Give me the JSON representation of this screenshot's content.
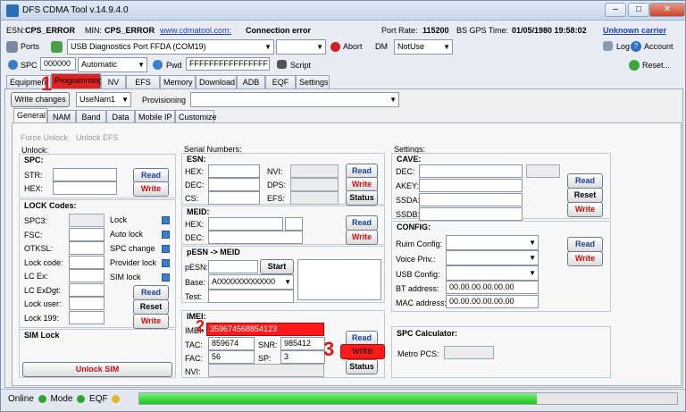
{
  "window": {
    "title": "DFS CDMA Tool v.14.9.4.0"
  },
  "infobar": {
    "esn_label": "ESN:",
    "esn_value": "CPS_ERROR",
    "min_label": "MIN:",
    "min_value": "CPS_ERROR",
    "website": "www.cdmatool.com:",
    "connection": "Connection error",
    "port_rate_label": "Port Rate:",
    "port_rate_value": "115200",
    "gps_label": "BS GPS Time:",
    "gps_value": "01/05/1980 19:58:02",
    "carrier": "Unknown carrier"
  },
  "toolbar1": {
    "ports_label": "Ports",
    "port_select": "USB Diagnostics Port FFDA (COM19)",
    "abort_label": "Abort",
    "dm_label": "DM",
    "dm_select": "NotUse",
    "log_label": "Log",
    "account_label": "Account"
  },
  "toolbar2": {
    "spc_label": "SPC",
    "spc_value": "000000",
    "spc_mode": "Automatic",
    "pwd_label": "Pwd",
    "pwd_value": "FFFFFFFFFFFFFFFF",
    "script_label": "Script",
    "reset_label": "Reset..."
  },
  "main_tabs": [
    "Equipment",
    "Programming",
    "NV",
    "EFS",
    "Memory",
    "Download",
    "ADB",
    "EQF",
    "Settings"
  ],
  "prog_toolbar": {
    "write_changes": "Write changes",
    "profile": "UseNam1",
    "provisioning_label": "Provisioning"
  },
  "sub_tabs": [
    "General",
    "NAM",
    "Band",
    "Data",
    "Mobile IP",
    "Customize"
  ],
  "unlock": {
    "title": "Unlock:",
    "force_unlock": "Force Unlock",
    "unlock_efs": "Unlock EFS",
    "spc_title": "SPC:",
    "str_label": "STR:",
    "hex_label": "HEX:",
    "read": "Read",
    "write": "Write",
    "lock_codes_title": "LOCK Codes:",
    "codes": [
      "SPC3:",
      "FSC:",
      "OTKSL:",
      "Lock code:",
      "LC Ex:",
      "LC ExDgt:",
      "Lock user:",
      "Lock 199:"
    ],
    "locks": [
      "Lock",
      "Auto lock",
      "SPC change",
      "Provider lock",
      "SIM lock"
    ],
    "reset": "Reset",
    "sim_lock_title": "SIM Lock",
    "unlock_sim": "Unlock SIM"
  },
  "serial": {
    "title": "Serial Numbers:",
    "esn_title": "ESN:",
    "hex_label": "HEX:",
    "dec_label": "DEC:",
    "cs_label": "CS:",
    "nvi_label": "NVI:",
    "dps_label": "DPS:",
    "efs_label": "EFS:",
    "read": "Read",
    "write": "Write",
    "status": "Status",
    "meid_title": "MEID:",
    "pesn_title": "pESN -> MEID",
    "pesn_label": "pESN:",
    "start": "Start",
    "base_label": "Base:",
    "base_value": "A0000000000000",
    "test_label": "Test:",
    "imei_title": "IMEI:",
    "imei_label": "IMEI:",
    "imei_value": "359674568854123",
    "tac_label": "TAC:",
    "tac_value": "859674",
    "snr_label": "SNR:",
    "snr_value": "985412",
    "fac_label": "FAC:",
    "fac_value": "56",
    "sp_label": "SP:",
    "sp_value": "3",
    "nvi2_label": "NVI:",
    "imei_write": "write"
  },
  "settings": {
    "title": "Settings:",
    "cave_title": "CAVE:",
    "dec_label": "DEC:",
    "akey_label": "AKEY:",
    "ssda_label": "SSDA:",
    "ssdb_label": "SSDB:",
    "read": "Read",
    "reset": "Reset",
    "write": "Write",
    "config_title": "CONFIG:",
    "ruim_label": "Ruim Config:",
    "voice_label": "Voice Priv.:",
    "usb_label": "USB Config:",
    "bt_label": "BT address:",
    "bt_value": "00.00.00.00.00.00",
    "mac_label": "MAC address:",
    "mac_value": "00.00.00.00.00.00",
    "spc_calc_title": "SPC Calculator:",
    "metro_label": "Metro PCS:"
  },
  "annotations": [
    "1",
    "2",
    "3"
  ],
  "status": {
    "online": "Online",
    "mode": "Mode",
    "eqf": "EQF",
    "progress": 0.74
  }
}
